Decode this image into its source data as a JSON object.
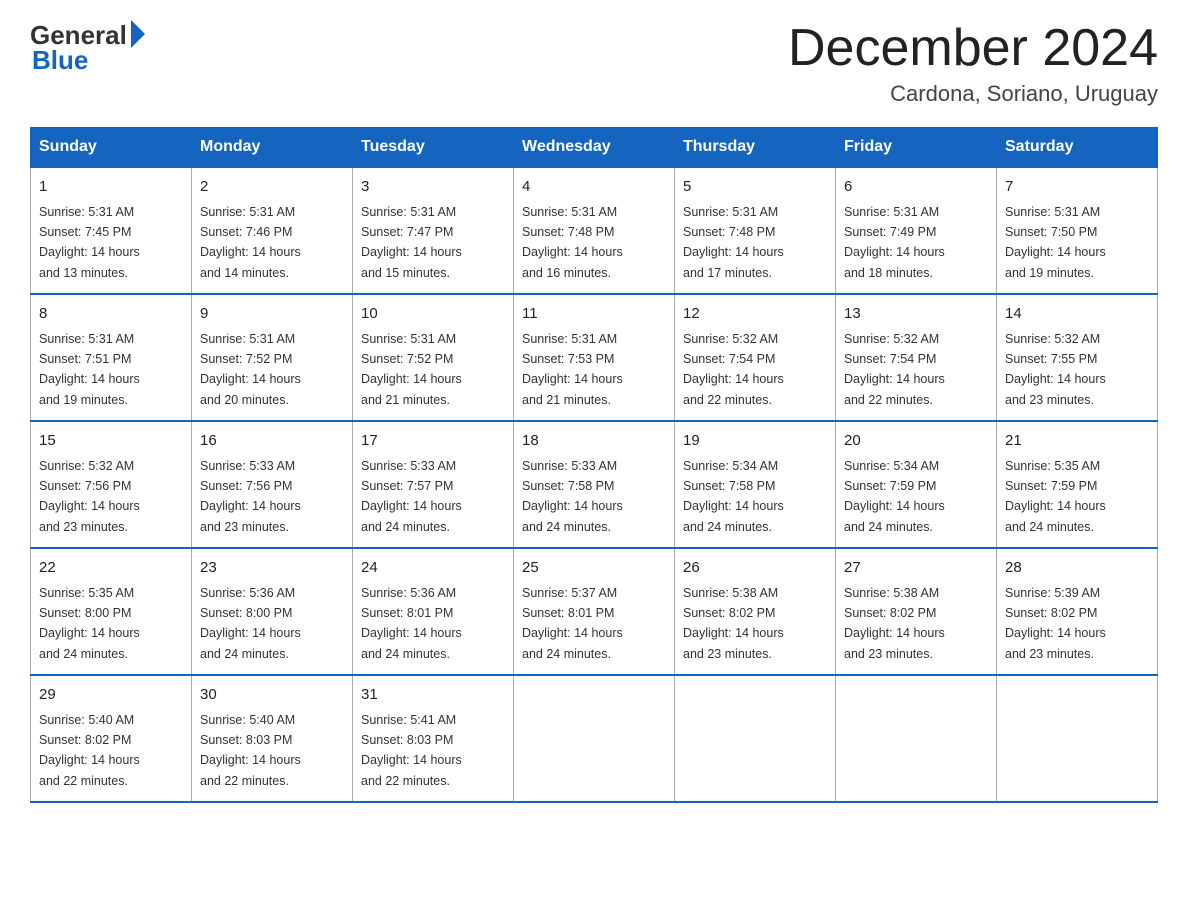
{
  "logo": {
    "general": "General",
    "blue": "Blue"
  },
  "title": "December 2024",
  "location": "Cardona, Soriano, Uruguay",
  "days_of_week": [
    "Sunday",
    "Monday",
    "Tuesday",
    "Wednesday",
    "Thursday",
    "Friday",
    "Saturday"
  ],
  "weeks": [
    [
      {
        "day": "1",
        "sunrise": "5:31 AM",
        "sunset": "7:45 PM",
        "daylight": "14 hours and 13 minutes."
      },
      {
        "day": "2",
        "sunrise": "5:31 AM",
        "sunset": "7:46 PM",
        "daylight": "14 hours and 14 minutes."
      },
      {
        "day": "3",
        "sunrise": "5:31 AM",
        "sunset": "7:47 PM",
        "daylight": "14 hours and 15 minutes."
      },
      {
        "day": "4",
        "sunrise": "5:31 AM",
        "sunset": "7:48 PM",
        "daylight": "14 hours and 16 minutes."
      },
      {
        "day": "5",
        "sunrise": "5:31 AM",
        "sunset": "7:48 PM",
        "daylight": "14 hours and 17 minutes."
      },
      {
        "day": "6",
        "sunrise": "5:31 AM",
        "sunset": "7:49 PM",
        "daylight": "14 hours and 18 minutes."
      },
      {
        "day": "7",
        "sunrise": "5:31 AM",
        "sunset": "7:50 PM",
        "daylight": "14 hours and 19 minutes."
      }
    ],
    [
      {
        "day": "8",
        "sunrise": "5:31 AM",
        "sunset": "7:51 PM",
        "daylight": "14 hours and 19 minutes."
      },
      {
        "day": "9",
        "sunrise": "5:31 AM",
        "sunset": "7:52 PM",
        "daylight": "14 hours and 20 minutes."
      },
      {
        "day": "10",
        "sunrise": "5:31 AM",
        "sunset": "7:52 PM",
        "daylight": "14 hours and 21 minutes."
      },
      {
        "day": "11",
        "sunrise": "5:31 AM",
        "sunset": "7:53 PM",
        "daylight": "14 hours and 21 minutes."
      },
      {
        "day": "12",
        "sunrise": "5:32 AM",
        "sunset": "7:54 PM",
        "daylight": "14 hours and 22 minutes."
      },
      {
        "day": "13",
        "sunrise": "5:32 AM",
        "sunset": "7:54 PM",
        "daylight": "14 hours and 22 minutes."
      },
      {
        "day": "14",
        "sunrise": "5:32 AM",
        "sunset": "7:55 PM",
        "daylight": "14 hours and 23 minutes."
      }
    ],
    [
      {
        "day": "15",
        "sunrise": "5:32 AM",
        "sunset": "7:56 PM",
        "daylight": "14 hours and 23 minutes."
      },
      {
        "day": "16",
        "sunrise": "5:33 AM",
        "sunset": "7:56 PM",
        "daylight": "14 hours and 23 minutes."
      },
      {
        "day": "17",
        "sunrise": "5:33 AM",
        "sunset": "7:57 PM",
        "daylight": "14 hours and 24 minutes."
      },
      {
        "day": "18",
        "sunrise": "5:33 AM",
        "sunset": "7:58 PM",
        "daylight": "14 hours and 24 minutes."
      },
      {
        "day": "19",
        "sunrise": "5:34 AM",
        "sunset": "7:58 PM",
        "daylight": "14 hours and 24 minutes."
      },
      {
        "day": "20",
        "sunrise": "5:34 AM",
        "sunset": "7:59 PM",
        "daylight": "14 hours and 24 minutes."
      },
      {
        "day": "21",
        "sunrise": "5:35 AM",
        "sunset": "7:59 PM",
        "daylight": "14 hours and 24 minutes."
      }
    ],
    [
      {
        "day": "22",
        "sunrise": "5:35 AM",
        "sunset": "8:00 PM",
        "daylight": "14 hours and 24 minutes."
      },
      {
        "day": "23",
        "sunrise": "5:36 AM",
        "sunset": "8:00 PM",
        "daylight": "14 hours and 24 minutes."
      },
      {
        "day": "24",
        "sunrise": "5:36 AM",
        "sunset": "8:01 PM",
        "daylight": "14 hours and 24 minutes."
      },
      {
        "day": "25",
        "sunrise": "5:37 AM",
        "sunset": "8:01 PM",
        "daylight": "14 hours and 24 minutes."
      },
      {
        "day": "26",
        "sunrise": "5:38 AM",
        "sunset": "8:02 PM",
        "daylight": "14 hours and 23 minutes."
      },
      {
        "day": "27",
        "sunrise": "5:38 AM",
        "sunset": "8:02 PM",
        "daylight": "14 hours and 23 minutes."
      },
      {
        "day": "28",
        "sunrise": "5:39 AM",
        "sunset": "8:02 PM",
        "daylight": "14 hours and 23 minutes."
      }
    ],
    [
      {
        "day": "29",
        "sunrise": "5:40 AM",
        "sunset": "8:02 PM",
        "daylight": "14 hours and 22 minutes."
      },
      {
        "day": "30",
        "sunrise": "5:40 AM",
        "sunset": "8:03 PM",
        "daylight": "14 hours and 22 minutes."
      },
      {
        "day": "31",
        "sunrise": "5:41 AM",
        "sunset": "8:03 PM",
        "daylight": "14 hours and 22 minutes."
      },
      null,
      null,
      null,
      null
    ]
  ],
  "labels": {
    "sunrise": "Sunrise:",
    "sunset": "Sunset:",
    "daylight": "Daylight:"
  }
}
